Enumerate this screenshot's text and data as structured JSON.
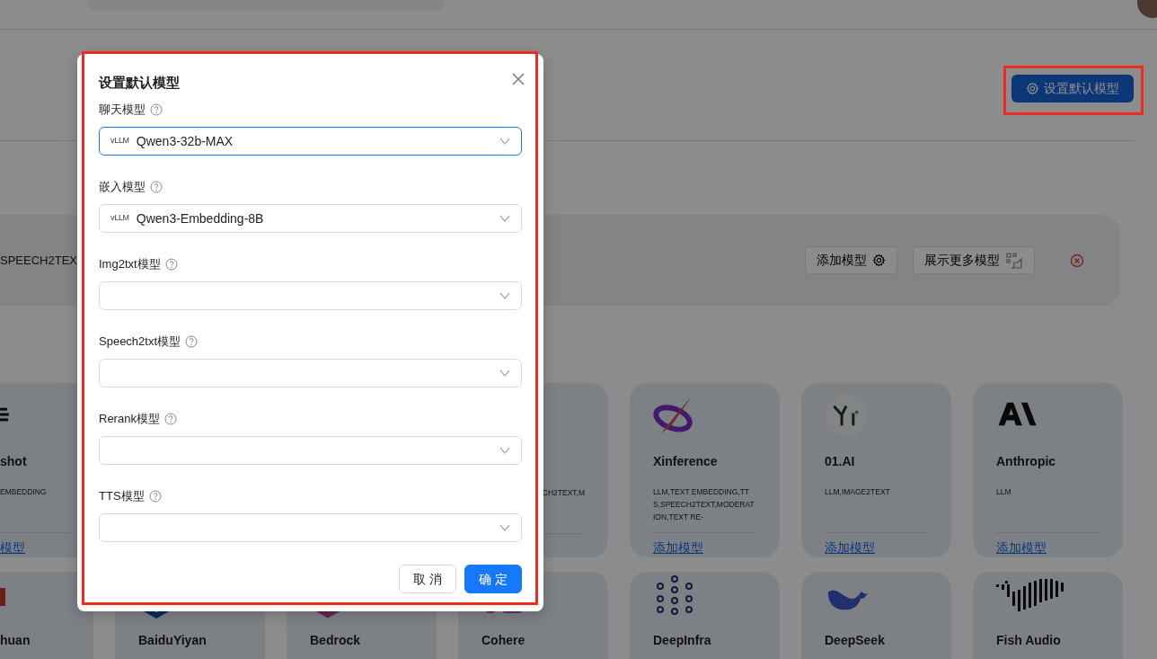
{
  "page": {
    "set_default_button": "设置默认模型",
    "provider_panel": {
      "tags": "SPEECH2TEX",
      "add_button": "添加模型",
      "more_button": "展示更多模型"
    },
    "provider_cards": [
      {
        "name": "shot",
        "tags": "EMBEDDING",
        "link": "模型"
      },
      {
        "tags": "CH2TEXT,M",
        "kind": "behind-dialog"
      },
      {
        "name": "Xinference",
        "tags": "LLM,TEXT EMBEDDING,TTS,SPEECH2TEXT,MODERATION,TEXT RE-",
        "link": "添加模型"
      },
      {
        "name": "01.AI",
        "tags": "LLM,IMAGE2TEXT",
        "link": "添加模型"
      },
      {
        "name": "Anthropic",
        "tags": "LLM",
        "link": "添加模型"
      },
      {
        "name": "huan"
      },
      {
        "name": "BaiduYiyan"
      },
      {
        "name": "Bedrock"
      },
      {
        "name": "Cohere"
      },
      {
        "name": "DeepInfra"
      },
      {
        "name": "DeepSeek"
      },
      {
        "name": "Fish Audio"
      }
    ]
  },
  "dialog": {
    "title": "设置默认模型",
    "fields": [
      {
        "label": "聊天模型",
        "provider_logo": "vLLM",
        "value": "Qwen3-32b-MAX",
        "focused": true
      },
      {
        "label": "嵌入模型",
        "provider_logo": "vLLM",
        "value": "Qwen3-Embedding-8B",
        "focused": false
      },
      {
        "label": "Img2txt模型",
        "focused": false
      },
      {
        "label": "Speech2txt模型",
        "focused": false
      },
      {
        "label": "Rerank模型",
        "focused": false
      },
      {
        "label": "TTS模型",
        "focused": false
      }
    ],
    "buttons": [
      {
        "label": "取 消",
        "kind": "default"
      },
      {
        "label": "确 定",
        "kind": "primary"
      }
    ]
  }
}
